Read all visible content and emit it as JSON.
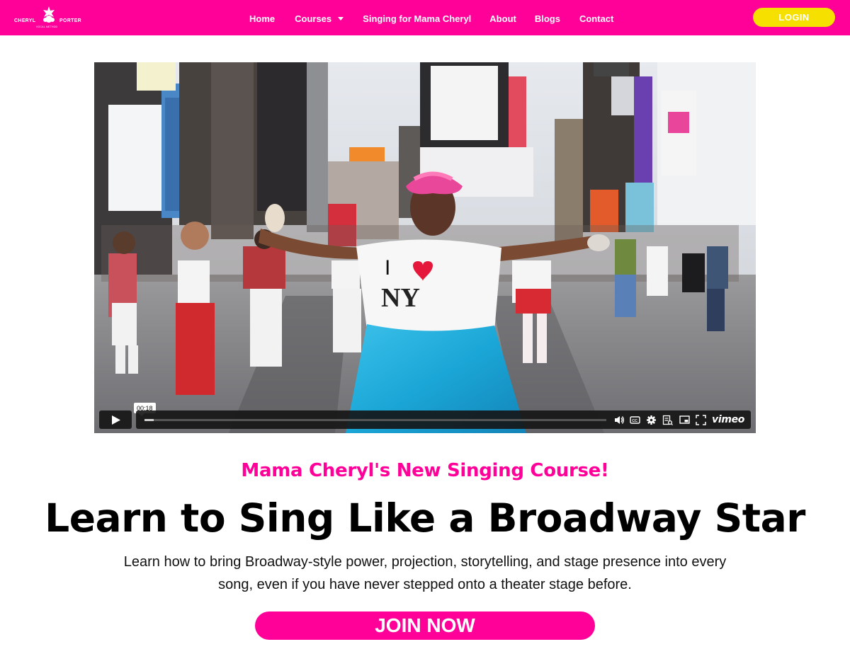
{
  "nav": {
    "logo": {
      "left_word": "CHERYL",
      "right_word": "PORTER",
      "sub": "VOCAL METHOD"
    },
    "items": [
      {
        "label": "Home"
      },
      {
        "label": "Courses",
        "has_dropdown": true
      },
      {
        "label": "Singing for Mama Cheryl"
      },
      {
        "label": "About"
      },
      {
        "label": "Blogs"
      },
      {
        "label": "Contact"
      }
    ],
    "login_label": "LOGIN"
  },
  "video": {
    "current_time": "00:18",
    "progress_fraction": 0.02,
    "controls": [
      "volume-icon",
      "closed-captions-icon",
      "settings-icon",
      "transcript-icon",
      "picture-in-picture-icon",
      "fullscreen-icon"
    ],
    "brand": "vimeo",
    "shirt_text": {
      "line1": "I",
      "line2": "NY"
    }
  },
  "hero": {
    "eyebrow": "Mama Cheryl's New Singing Course!",
    "headline": "Learn to Sing Like a Broadway Star",
    "description": "Learn how to bring Broadway-style power, projection, storytelling, and stage presence into every song, even if you have never stepped onto a theater stage before.",
    "cta_label": "JOIN NOW"
  },
  "colors": {
    "brand_pink": "#ff0099",
    "login_yellow": "#f5e000",
    "skirt_teal": "#1aa6d6"
  }
}
